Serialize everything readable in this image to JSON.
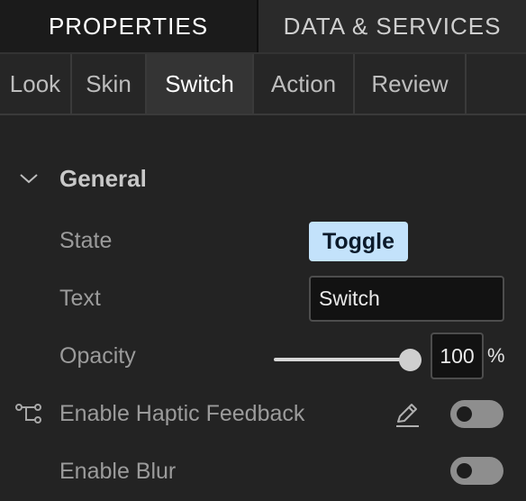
{
  "top_tabs": [
    {
      "label": "PROPERTIES",
      "active": true
    },
    {
      "label": "DATA & SERVICES",
      "active": false
    }
  ],
  "sub_tabs": [
    {
      "label": "Look",
      "active": false
    },
    {
      "label": "Skin",
      "active": false
    },
    {
      "label": "Switch",
      "active": true
    },
    {
      "label": "Action",
      "active": false
    },
    {
      "label": "Review",
      "active": false
    }
  ],
  "section": {
    "title": "General",
    "expanded": true,
    "icon": "chevron-down-icon"
  },
  "fields": {
    "state": {
      "label": "State",
      "value": "Toggle"
    },
    "text": {
      "label": "Text",
      "value": "Switch"
    },
    "opacity": {
      "label": "Opacity",
      "value": "100",
      "unit": "%",
      "slider_level": 1.0
    },
    "haptic": {
      "label": "Enable Haptic Feedback",
      "enabled": false,
      "icons": [
        "tree-icon",
        "pencil-icon"
      ]
    },
    "blur": {
      "label": "Enable Blur",
      "enabled": false
    }
  },
  "colors": {
    "background": "#232323",
    "state_badge_bg": "#c3e2fb",
    "toggle_off": "#8e8e8e"
  }
}
